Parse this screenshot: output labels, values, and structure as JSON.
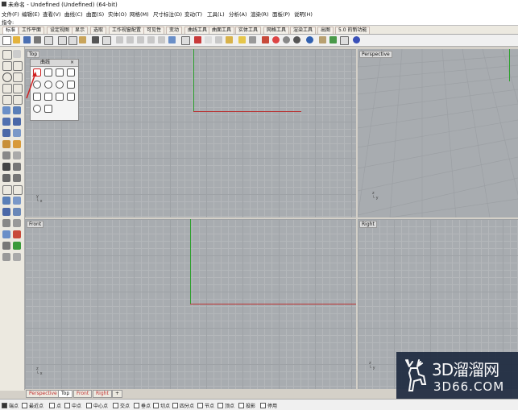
{
  "window": {
    "title": "未命名 - Undefined (Undefined) (64-bit)"
  },
  "menu": [
    "文件(F)",
    "编辑(E)",
    "查看(V)",
    "曲线(C)",
    "曲面(S)",
    "实体(O)",
    "网格(M)",
    "尺寸标注(D)",
    "变动(T)",
    "工具(L)",
    "分析(A)",
    "渲染(R)",
    "面板(P)",
    "说明(H)"
  ],
  "command": {
    "prompt": "指令:"
  },
  "tabs": [
    "标准",
    "工作平面",
    "设定视图",
    "显示",
    "选取",
    "工作视窗配置",
    "可见性",
    "变动",
    "曲线工具",
    "曲面工具",
    "实体工具",
    "网格工具",
    "渲染工具",
    "出图",
    "5.0 的新功能"
  ],
  "active_tab": "标准",
  "floating_panel": {
    "title": "曲线"
  },
  "viewports": {
    "top": {
      "label": "Top"
    },
    "perspective": {
      "label": "Perspective"
    },
    "front": {
      "label": "Front"
    },
    "right": {
      "label": "Right"
    }
  },
  "viewport_tabs": [
    "Perspective",
    "Top",
    "Front",
    "Right"
  ],
  "active_viewport_tab": "Top",
  "osnap": [
    {
      "label": "端点",
      "checked": true
    },
    {
      "label": "最近点",
      "checked": false
    },
    {
      "label": "点",
      "checked": false
    },
    {
      "label": "中点",
      "checked": false
    },
    {
      "label": "中心点",
      "checked": false
    },
    {
      "label": "交点",
      "checked": false
    },
    {
      "label": "垂点",
      "checked": false
    },
    {
      "label": "切点",
      "checked": false
    },
    {
      "label": "四分点",
      "checked": false
    },
    {
      "label": "节点",
      "checked": false
    },
    {
      "label": "顶点",
      "checked": false
    },
    {
      "label": "投影",
      "checked": false
    },
    {
      "label": "停用",
      "checked": false
    }
  ],
  "watermark": {
    "line1": "3D溜溜网",
    "line2": "3D66.COM"
  },
  "colors": {
    "axis_x": "#b83232",
    "axis_y": "#2ea02e",
    "viewport_bg": "#a8acb0",
    "watermark_bg": "#1e2a40"
  }
}
